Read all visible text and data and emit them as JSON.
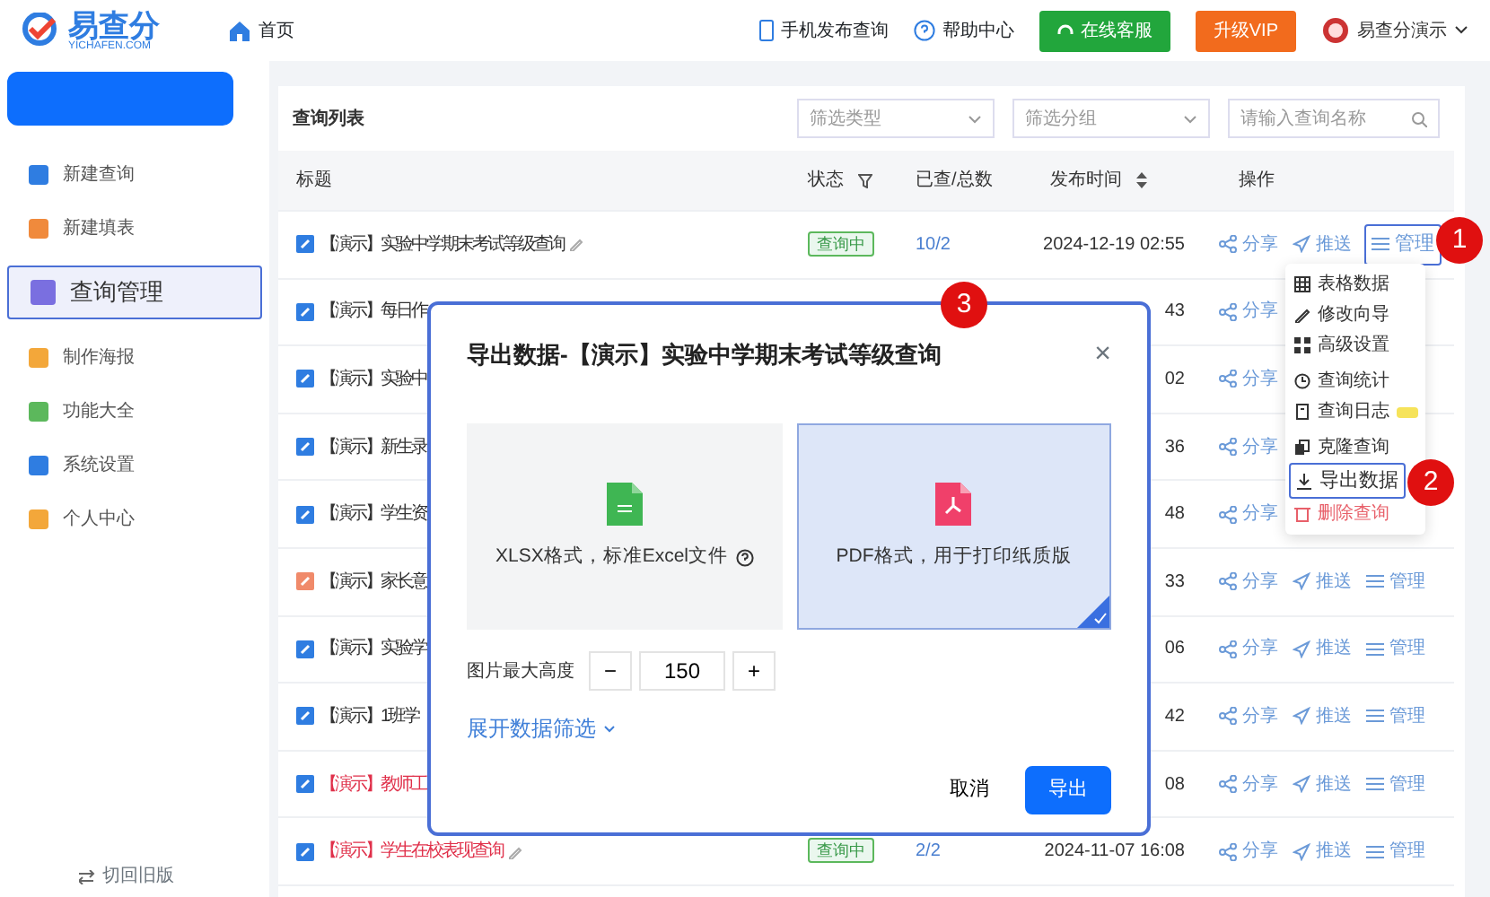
{
  "header": {
    "logo": {
      "name": "易查分",
      "domain": "YICHAFEN.COM"
    },
    "home": "首页",
    "links": [
      "手机发布查询",
      "帮助中心"
    ],
    "service_button": "在线客服",
    "vip_button": "升级VIP",
    "user": "易查分演示"
  },
  "sidebar": {
    "items": [
      {
        "label": "新建查询",
        "color": "#2f7de1",
        "selected": false
      },
      {
        "label": "新建填表",
        "color": "#f08a3c",
        "selected": false
      },
      {
        "label": "查询管理",
        "color": "#7a6fe0",
        "selected": true
      },
      {
        "label": "制作海报",
        "color": "#f3a73a",
        "selected": false
      },
      {
        "label": "功能大全",
        "color": "#5cb85c",
        "selected": false
      },
      {
        "label": "系统设置",
        "color": "#2f7de1",
        "selected": false
      },
      {
        "label": "个人中心",
        "color": "#f3a73a",
        "selected": false
      }
    ],
    "footer": "切回旧版"
  },
  "list": {
    "title": "查询列表",
    "filters": [
      {
        "kind": "select",
        "placeholder": "筛选类型"
      },
      {
        "kind": "select",
        "placeholder": "筛选分组"
      },
      {
        "kind": "search",
        "placeholder": "请输入查询名称"
      }
    ],
    "columns": [
      "标题",
      "状态",
      "已查/总数",
      "发布时间",
      "操作"
    ],
    "rows": [
      {
        "title": "【演示】实验中学期末考试等级查询",
        "alert": false,
        "color": "#2f7de1",
        "status": "查询中",
        "count": "10/2",
        "time": "2024-12-19 02:55",
        "actions": [
          {
            "label": "分享",
            "highlighted": false
          },
          {
            "label": "推送",
            "highlighted": false
          },
          {
            "label": "管理",
            "highlighted": true
          }
        ]
      },
      {
        "title": "【演示】每日作",
        "alert": false,
        "color": "#2f7de1",
        "time": "43",
        "actions": [
          {
            "label": "分享",
            "highlighted": false
          }
        ]
      },
      {
        "title": "【演示】实验中",
        "alert": false,
        "color": "#2f7de1",
        "time": "02",
        "actions": [
          {
            "label": "分享",
            "highlighted": false
          }
        ]
      },
      {
        "title": "【演示】新生录",
        "alert": false,
        "color": "#2f7de1",
        "time": "36",
        "actions": [
          {
            "label": "分享",
            "highlighted": false
          }
        ]
      },
      {
        "title": "【演示】学生资",
        "alert": false,
        "color": "#2f7de1",
        "time": "48",
        "actions": [
          {
            "label": "分享",
            "highlighted": false
          }
        ]
      },
      {
        "title": "【演示】家长意",
        "alert": false,
        "color": "#f08a6a",
        "time": "33",
        "actions": [
          {
            "label": "分享",
            "highlighted": false
          },
          {
            "label": "推送",
            "highlighted": false
          },
          {
            "label": "管理",
            "highlighted": false
          }
        ]
      },
      {
        "title": "【演示】实验学",
        "alert": false,
        "color": "#2f7de1",
        "time": "06",
        "actions": [
          {
            "label": "分享",
            "highlighted": false
          },
          {
            "label": "推送",
            "highlighted": false
          },
          {
            "label": "管理",
            "highlighted": false
          }
        ]
      },
      {
        "title": "【演示】1班学",
        "alert": false,
        "color": "#2f7de1",
        "time": "42",
        "actions": [
          {
            "label": "分享",
            "highlighted": false
          },
          {
            "label": "推送",
            "highlighted": false
          },
          {
            "label": "管理",
            "highlighted": false
          }
        ]
      },
      {
        "title": "【演示】教师工",
        "alert": true,
        "color": "#2f7de1",
        "time": "08",
        "actions": [
          {
            "label": "分享",
            "highlighted": false
          },
          {
            "label": "推送",
            "highlighted": false
          },
          {
            "label": "管理",
            "highlighted": false
          }
        ]
      },
      {
        "title": "【演示】学生在校表现查询",
        "alert": true,
        "color": "#2f7de1",
        "status": "查询中",
        "count": "2/2",
        "time": "2024-11-07 16:08",
        "actions": [
          {
            "label": "分享",
            "highlighted": false
          },
          {
            "label": "推送",
            "highlighted": false
          },
          {
            "label": "管理",
            "highlighted": false
          }
        ]
      }
    ]
  },
  "manage_menu": [
    {
      "label": "表格数据",
      "kind": "grid",
      "highlighted": false
    },
    {
      "label": "修改向导",
      "kind": "pencil",
      "highlighted": false
    },
    {
      "label": "高级设置",
      "kind": "squares",
      "highlighted": false
    },
    {
      "label": "查询统计",
      "kind": "clock",
      "highlighted": false
    },
    {
      "label": "查询日志",
      "kind": "doc",
      "highlighted": false,
      "tag": true
    },
    {
      "label": "克隆查询",
      "kind": "copy",
      "highlighted": false
    },
    {
      "label": "导出数据",
      "kind": "download",
      "highlighted": true
    },
    {
      "label": "删除查询",
      "kind": "trash",
      "highlighted": false,
      "danger": true
    }
  ],
  "dialog": {
    "title": "导出数据-【演示】实验中学期末考试等级查询",
    "close": "×",
    "options": [
      {
        "kind": "xlsx",
        "label": "XLSX格式，标准Excel文件",
        "selected": false
      },
      {
        "kind": "pdf",
        "label": "PDF格式，用于打印纸质版",
        "selected": true
      }
    ],
    "stepper": {
      "label": "图片最大高度",
      "minus": "−",
      "value": "150",
      "plus": "+"
    },
    "expand_link": "展开数据筛选",
    "buttons": [
      {
        "kind": "secondary",
        "label": "取消"
      },
      {
        "kind": "primary",
        "label": "导出"
      }
    ]
  },
  "annotations": [
    "1",
    "2",
    "3"
  ]
}
